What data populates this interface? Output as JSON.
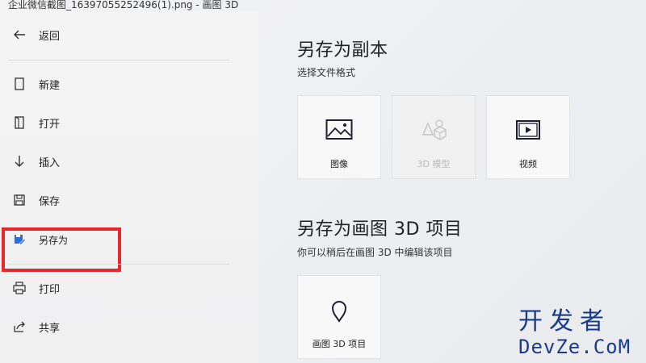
{
  "window": {
    "title": "企业微信截图_16397055252496(1).png - 画图 3D"
  },
  "sidebar": {
    "back_label": "返回",
    "items": [
      {
        "label": "新建",
        "icon": "new-file-icon"
      },
      {
        "label": "打开",
        "icon": "open-icon"
      },
      {
        "label": "插入",
        "icon": "insert-icon"
      },
      {
        "label": "保存",
        "icon": "save-icon"
      },
      {
        "label": "另存为",
        "icon": "save-as-icon"
      },
      {
        "label": "打印",
        "icon": "print-icon"
      },
      {
        "label": "共享",
        "icon": "share-icon"
      }
    ],
    "highlight_color": "#e8262b"
  },
  "copy_section": {
    "title": "另存为副本",
    "subtitle": "选择文件格式",
    "cards": [
      {
        "label": "图像",
        "icon": "image-icon",
        "enabled": true
      },
      {
        "label": "3D 模型",
        "icon": "3d-model-icon",
        "enabled": false
      },
      {
        "label": "视频",
        "icon": "video-icon",
        "enabled": true
      }
    ]
  },
  "project_section": {
    "title": "另存为画图 3D 项目",
    "subtitle": "你可以稍后在画图 3D 中编辑该项目",
    "card": {
      "label": "画图 3D 项目",
      "icon": "paint3d-project-icon"
    }
  },
  "watermark": {
    "text_cn": "开发者",
    "text_en": "DevZe.CoM"
  }
}
